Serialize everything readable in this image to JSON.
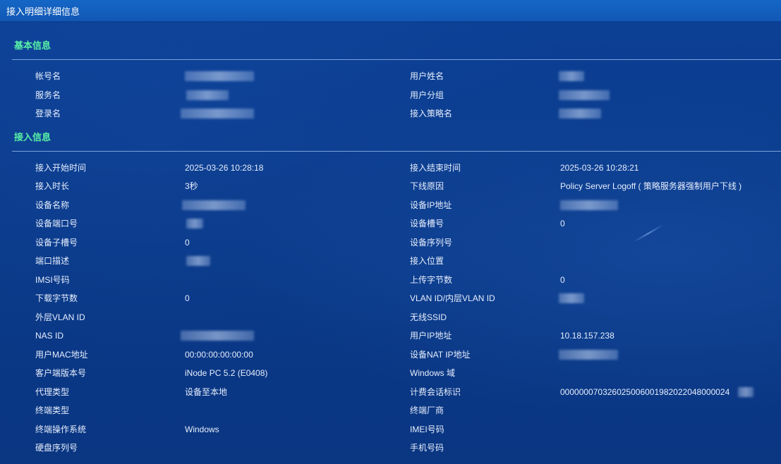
{
  "window": {
    "title": "接入明细详细信息"
  },
  "sections": {
    "basic": {
      "title": "基本信息",
      "rows": [
        {
          "left_label": "帐号名",
          "left_value": "",
          "right_label": "用户姓名",
          "right_value": ""
        },
        {
          "left_label": "服务名",
          "left_value": "",
          "right_label": "用户分组",
          "right_value": ""
        },
        {
          "left_label": "登录名",
          "left_value": "",
          "right_label": "接入策略名",
          "right_value": ""
        }
      ]
    },
    "access": {
      "title": "接入信息",
      "rows": [
        {
          "left_label": "接入开始时间",
          "left_value": "2025-03-26 10:28:18",
          "right_label": "接入结束时间",
          "right_value": "2025-03-26 10:28:21"
        },
        {
          "left_label": "接入时长",
          "left_value": "3秒",
          "right_label": "下线原因",
          "right_value": "Policy Server Logoff ( 策略服务器强制用户下线 )"
        },
        {
          "left_label": "设备名称",
          "left_value": "",
          "right_label": "设备IP地址",
          "right_value": ""
        },
        {
          "left_label": "设备端口号",
          "left_value": "",
          "right_label": "设备槽号",
          "right_value": "0"
        },
        {
          "left_label": "设备子槽号",
          "left_value": "0",
          "right_label": "设备序列号",
          "right_value": ""
        },
        {
          "left_label": "端口描述",
          "left_value": "",
          "right_label": "接入位置",
          "right_value": ""
        },
        {
          "left_label": "IMSI号码",
          "left_value": "",
          "right_label": "上传字节数",
          "right_value": "0"
        },
        {
          "left_label": "下载字节数",
          "left_value": "0",
          "right_label": "VLAN ID/内层VLAN ID",
          "right_value": ""
        },
        {
          "left_label": "外层VLAN ID",
          "left_value": "",
          "right_label": "无线SSID",
          "right_value": ""
        },
        {
          "left_label": "NAS ID",
          "left_value": "",
          "right_label": "用户IP地址",
          "right_value": "10.18.157.238"
        },
        {
          "left_label": "用户MAC地址",
          "left_value": "00:00:00:00:00:00",
          "right_label": "设备NAT IP地址",
          "right_value": ""
        },
        {
          "left_label": "客户端版本号",
          "left_value": "iNode PC 5.2 (E0408)",
          "right_label": "Windows 域",
          "right_value": ""
        },
        {
          "left_label": "代理类型",
          "left_value": "设备至本地",
          "right_label": "计费会话标识",
          "right_value": "000000070326025006001982022048000024"
        },
        {
          "left_label": "终端类型",
          "left_value": "",
          "right_label": "终端厂商",
          "right_value": ""
        },
        {
          "left_label": "终端操作系统",
          "left_value": "Windows",
          "right_label": "IMEI号码",
          "right_value": ""
        },
        {
          "left_label": "硬盘序列号",
          "left_value": "",
          "right_label": "手机号码",
          "right_value": ""
        }
      ]
    }
  }
}
